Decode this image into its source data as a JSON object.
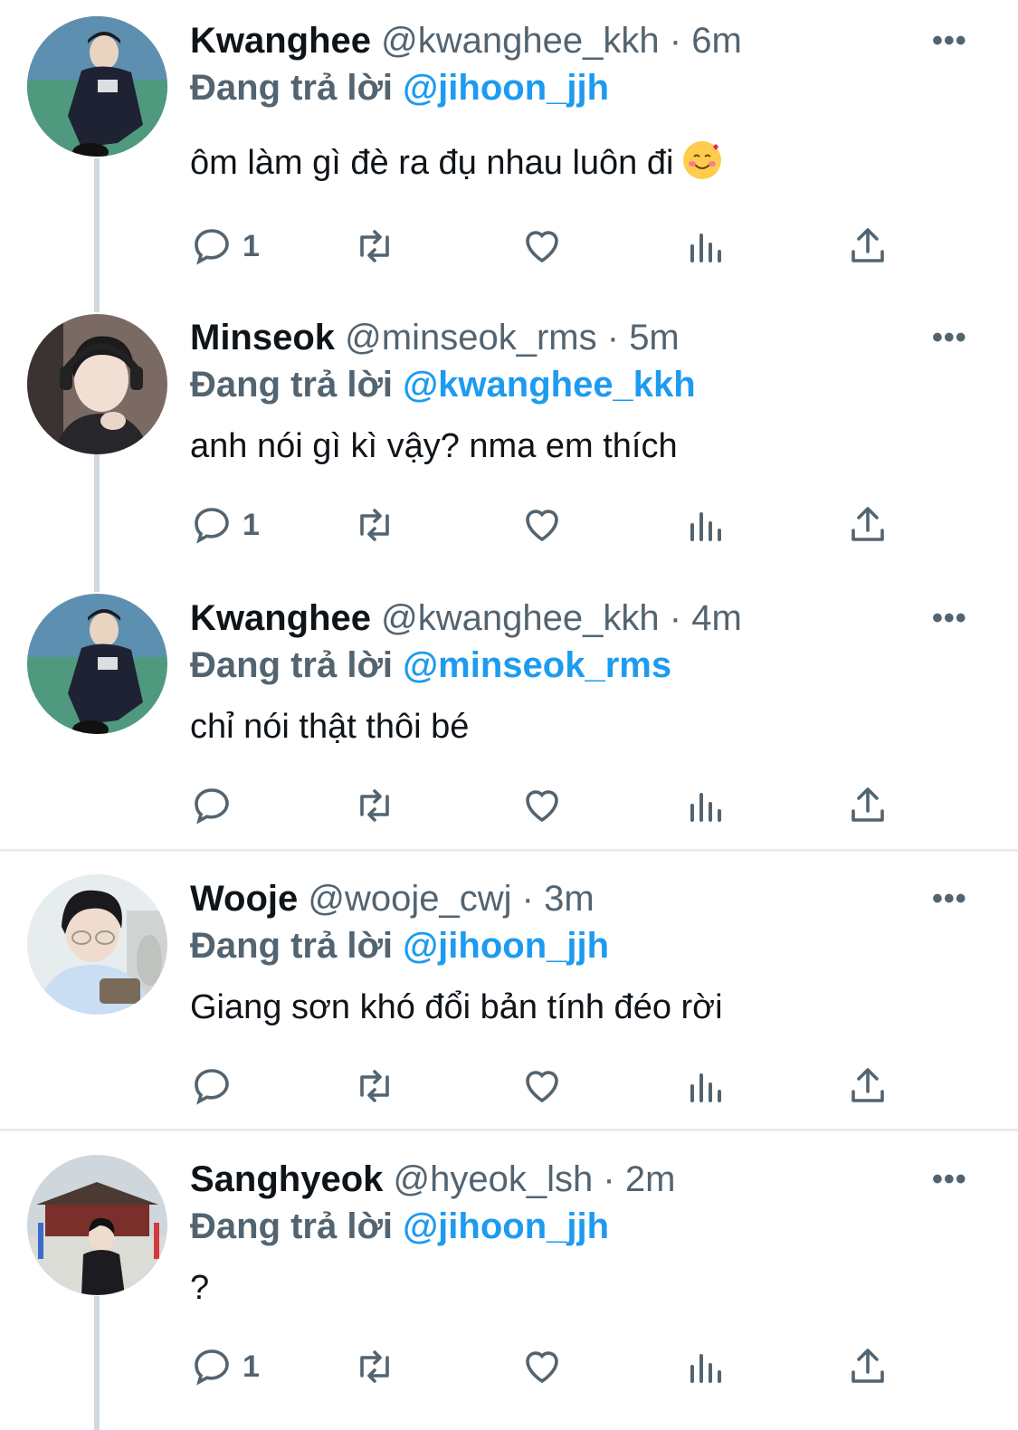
{
  "reply_prefix": "Đang trả lời",
  "more_label": "•••",
  "tweets": [
    {
      "name": "Kwanghee",
      "handle": "@kwanghee_kkh",
      "dot": "·",
      "time": "6m",
      "reply_to": "@jihoon_jjh",
      "text": "ôm làm gì đè ra đụ nhau luôn đi",
      "emoji": "smiling-face-with-hearts",
      "reply_count": "1"
    },
    {
      "name": "Minseok",
      "handle": "@minseok_rms",
      "dot": "·",
      "time": "5m",
      "reply_to": "@kwanghee_kkh",
      "text": "anh nói gì kì vậy? nma em thích",
      "reply_count": "1"
    },
    {
      "name": "Kwanghee",
      "handle": "@kwanghee_kkh",
      "dot": "·",
      "time": "4m",
      "reply_to": "@minseok_rms",
      "text": "chỉ nói thật thôi bé",
      "reply_count": ""
    },
    {
      "name": "Wooje",
      "handle": "@wooje_cwj",
      "dot": "·",
      "time": "3m",
      "reply_to": "@jihoon_jjh",
      "text": "Giang sơn khó đổi bản tính đéo rời",
      "reply_count": ""
    },
    {
      "name": "Sanghyeok",
      "handle": "@hyeok_lsh",
      "dot": "·",
      "time": "2m",
      "reply_to": "@jihoon_jjh",
      "text": "?",
      "reply_count": "1"
    }
  ],
  "colors": {
    "name": "#0f1419",
    "muted": "#536471",
    "mention": "#1d9bf0",
    "thread_line": "#cfd9de",
    "divider": "#e6ecf0"
  }
}
